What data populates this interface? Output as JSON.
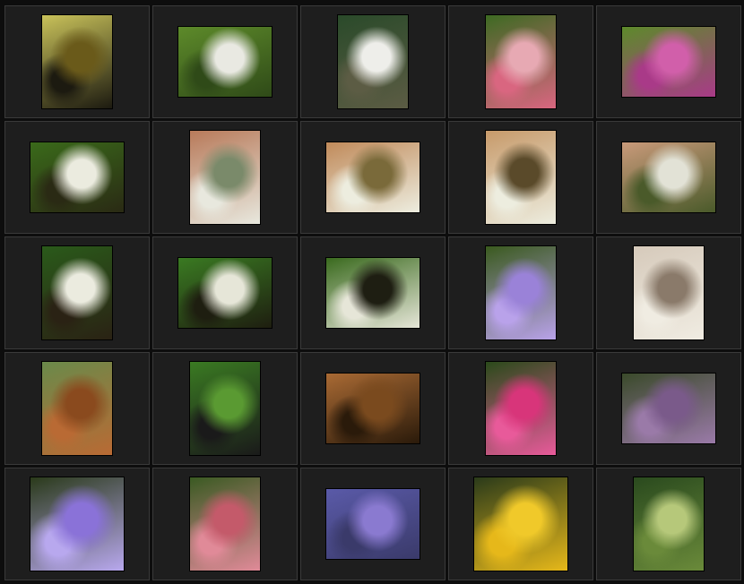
{
  "gallery": {
    "thumbnails": [
      {
        "icon": "turtle-photo",
        "shape": "p",
        "colors": [
          "#c9c25a",
          "#6a5a1a",
          "#1c1a10"
        ]
      },
      {
        "icon": "geese-on-grass-photo",
        "shape": "l",
        "colors": [
          "#5d8a2a",
          "#e9e9e2",
          "#2f4a18"
        ]
      },
      {
        "icon": "swans-on-water-photo",
        "shape": "p",
        "colors": [
          "#2a4a2a",
          "#eeeeea",
          "#5c5c44"
        ]
      },
      {
        "icon": "pink-flowers-photo",
        "shape": "p",
        "colors": [
          "#3d6a22",
          "#e7a9b3",
          "#d96680"
        ]
      },
      {
        "icon": "magenta-flowers-photo",
        "shape": "l",
        "colors": [
          "#5c8a2a",
          "#d15faa",
          "#a93a88"
        ]
      },
      {
        "icon": "bee-on-white-flowers-photo",
        "shape": "l",
        "colors": [
          "#3a6a1a",
          "#ebebdf",
          "#2a2a14"
        ]
      },
      {
        "icon": "bee-with-brick-background-photo",
        "shape": "p",
        "colors": [
          "#b87a5a",
          "#7a8a6a",
          "#e8e8de"
        ]
      },
      {
        "icon": "bee-closeup-brick-photo",
        "shape": "l",
        "colors": [
          "#c08a5a",
          "#7a6a3a",
          "#ededdf"
        ]
      },
      {
        "icon": "bee-hovering-photo",
        "shape": "p",
        "colors": [
          "#c79a6a",
          "#5a4a2a",
          "#ededdf"
        ]
      },
      {
        "icon": "bee-on-flowers-wall-photo",
        "shape": "l",
        "colors": [
          "#c99a7a",
          "#e2e2d6",
          "#4a5a2a"
        ]
      },
      {
        "icon": "bumblebee-on-white-flowers-photo",
        "shape": "p",
        "colors": [
          "#2a5a1a",
          "#ebebdf",
          "#2a2214"
        ]
      },
      {
        "icon": "bumblebee-leaves-photo",
        "shape": "l",
        "colors": [
          "#3a7a22",
          "#e6e6d8",
          "#1e1e10"
        ]
      },
      {
        "icon": "bumblebee-closeup-photo",
        "shape": "l",
        "colors": [
          "#3a6a1e",
          "#1e1e12",
          "#e6e6d8"
        ]
      },
      {
        "icon": "purple-clematis-photo",
        "shape": "p",
        "colors": [
          "#3a5a1e",
          "#9a82d8",
          "#b9a2ea"
        ]
      },
      {
        "icon": "white-flower-cluster-photo",
        "shape": "p",
        "colors": [
          "#d6cabb",
          "#8a7a6a",
          "#f0ece2"
        ]
      },
      {
        "icon": "dog-portrait-photo",
        "shape": "p",
        "colors": [
          "#6a8a4a",
          "#8a4a1e",
          "#b96a34"
        ]
      },
      {
        "icon": "magpie-on-grass-photo",
        "shape": "p",
        "colors": [
          "#3a7a22",
          "#5a9a32",
          "#1a1a1a"
        ]
      },
      {
        "icon": "dog-eye-closeup-photo",
        "shape": "l",
        "colors": [
          "#a96a34",
          "#7a4a1e",
          "#2a1a0a"
        ]
      },
      {
        "icon": "pink-petunias-photo",
        "shape": "p",
        "colors": [
          "#2a4a1a",
          "#d8357a",
          "#e85a9a"
        ]
      },
      {
        "icon": "allium-flower-photo",
        "shape": "l",
        "colors": [
          "#3a4a2a",
          "#7a5a8a",
          "#9a7aa8"
        ]
      },
      {
        "icon": "purple-clematis-closeup-photo",
        "shape": "s",
        "colors": [
          "#2a3a1a",
          "#8a72d8",
          "#b8a8ee"
        ]
      },
      {
        "icon": "red-valerian-photo",
        "shape": "p",
        "colors": [
          "#3a5a22",
          "#c45a6a",
          "#e08a98"
        ]
      },
      {
        "icon": "purple-blossoms-photo",
        "shape": "l",
        "colors": [
          "#5a5aa8",
          "#8a7ad0",
          "#3a3a6a"
        ]
      },
      {
        "icon": "yellow-daisies-photo",
        "shape": "s",
        "colors": [
          "#2a3a1a",
          "#f0c92a",
          "#e6b81a"
        ]
      },
      {
        "icon": "green-hellebore-photo",
        "shape": "p",
        "colors": [
          "#2a4a1e",
          "#b6c87a",
          "#6a8a3a"
        ]
      }
    ]
  }
}
